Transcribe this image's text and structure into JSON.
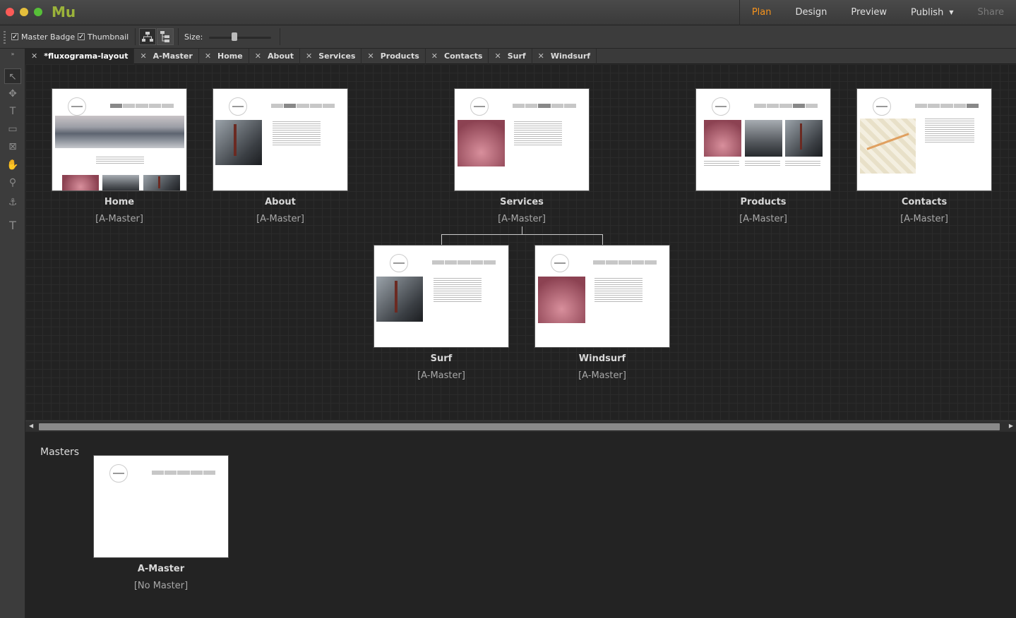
{
  "app": {
    "logo": "Mu"
  },
  "workspaces": [
    {
      "label": "Plan",
      "state": "active"
    },
    {
      "label": "Design",
      "state": "normal"
    },
    {
      "label": "Preview",
      "state": "normal"
    },
    {
      "label": "Publish",
      "state": "normal"
    },
    {
      "label": "Share",
      "state": "disabled"
    }
  ],
  "toolbar": {
    "master_badge": "Master Badge",
    "thumbnail": "Thumbnail",
    "size_label": "Size:",
    "size_value": 0.4
  },
  "tabs": [
    {
      "label": "*fluxograma-layout",
      "active": true
    },
    {
      "label": "A-Master"
    },
    {
      "label": "Home"
    },
    {
      "label": "About"
    },
    {
      "label": "Services"
    },
    {
      "label": "Products"
    },
    {
      "label": "Contacts"
    },
    {
      "label": "Surf"
    },
    {
      "label": "Windsurf"
    }
  ],
  "pages": {
    "home": {
      "name": "Home",
      "master": "[A-Master]"
    },
    "about": {
      "name": "About",
      "master": "[A-Master]"
    },
    "services": {
      "name": "Services",
      "master": "[A-Master]"
    },
    "products": {
      "name": "Products",
      "master": "[A-Master]"
    },
    "contacts": {
      "name": "Contacts",
      "master": "[A-Master]"
    },
    "surf": {
      "name": "Surf",
      "master": "[A-Master]"
    },
    "windsurf": {
      "name": "Windsurf",
      "master": "[A-Master]"
    }
  },
  "masters": {
    "title": "Masters",
    "a_master": {
      "name": "A-Master",
      "master": "[No Master]"
    }
  },
  "colors": {
    "accent": "#f7941d",
    "logo": "#9bb33a"
  }
}
